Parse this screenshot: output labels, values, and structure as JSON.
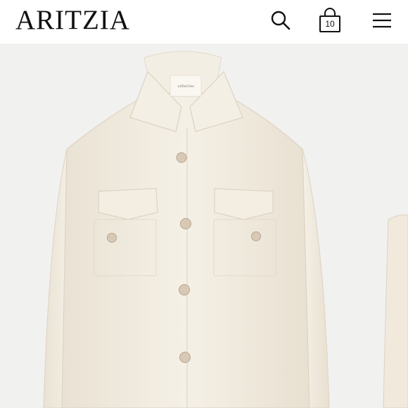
{
  "header": {
    "logo_text": "ARITZIA",
    "bag_count": "10",
    "icons": [
      "search-icon",
      "shopping-bag-icon",
      "hamburger-menu-icon"
    ]
  },
  "gallery": {
    "main_image": "cream-wool-shirt-jacket",
    "label_text": "wilfred free"
  },
  "colors": {
    "background": "#f1f1f0",
    "jacket": "#f2ece0",
    "buttons": "#d8c9b6",
    "text": "#111111"
  }
}
